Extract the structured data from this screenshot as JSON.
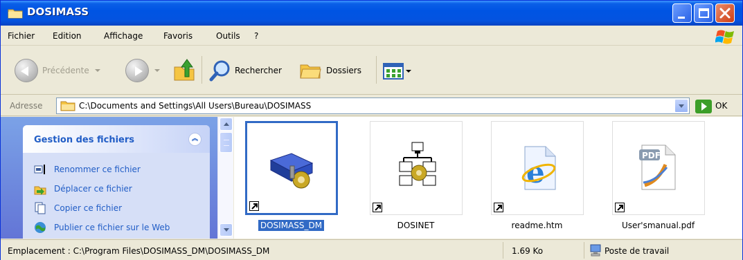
{
  "window": {
    "title": "DOSIMASS"
  },
  "menu": [
    {
      "label": "Fichier"
    },
    {
      "label": "Edition"
    },
    {
      "label": "Affichage"
    },
    {
      "label": "Favoris"
    },
    {
      "label": "Outils"
    },
    {
      "label": "?"
    }
  ],
  "toolbar": {
    "back_label": "Précédente",
    "search_label": "Rechercher",
    "folders_label": "Dossiers"
  },
  "address": {
    "label": "Adresse",
    "value": "C:\\Documents and Settings\\All Users\\Bureau\\DOSIMASS",
    "go_label": "OK"
  },
  "taskpane": {
    "title": "Gestion des fichiers",
    "items": [
      {
        "label": "Renommer ce fichier",
        "icon": "rename-icon"
      },
      {
        "label": "Déplacer ce fichier",
        "icon": "move-icon"
      },
      {
        "label": "Copier ce fichier",
        "icon": "copy-icon"
      },
      {
        "label": "Publier ce fichier sur le Web",
        "icon": "web-publish-icon"
      }
    ]
  },
  "files": [
    {
      "label": "DOSIMASS_DM",
      "icon": "dosimass-app-icon",
      "selected": true
    },
    {
      "label": "DOSINET",
      "icon": "dosinet-network-icon",
      "selected": false
    },
    {
      "label": "readme.htm",
      "icon": "internet-explorer-icon",
      "selected": false
    },
    {
      "label": "User'smanual.pdf",
      "icon": "pdf-icon",
      "selected": false
    }
  ],
  "status": {
    "location": "Emplacement : C:\\Program Files\\DOSIMASS_DM\\DOSIMASS_DM",
    "size": "1.69 Ko",
    "zone": "Poste de travail"
  },
  "colors": {
    "titlebar": "#0054e3",
    "selection": "#316ac5",
    "task_link": "#215dc6"
  }
}
